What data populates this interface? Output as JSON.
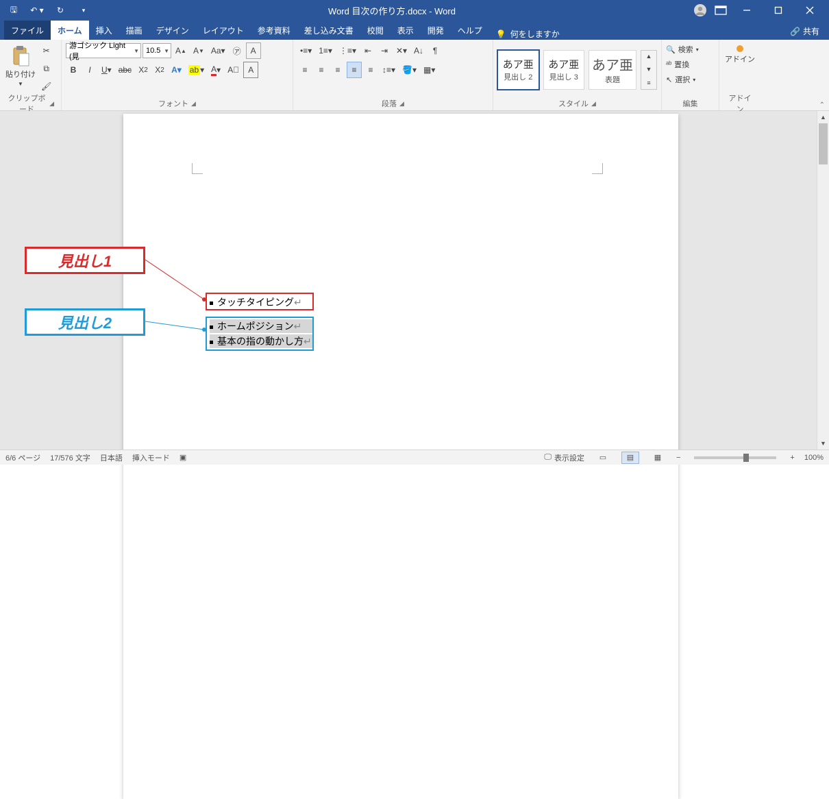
{
  "title": "Word  目次の作り方.docx  -  Word",
  "tabs": {
    "file": "ファイル",
    "home": "ホーム",
    "insert": "挿入",
    "draw": "描画",
    "design": "デザイン",
    "layout": "レイアウト",
    "references": "参考資料",
    "mailings": "差し込み文書",
    "review": "校閲",
    "view": "表示",
    "developer": "開発",
    "help": "ヘルプ"
  },
  "tellme": "何をしますか",
  "share": "共有",
  "ribbon": {
    "clipboard": {
      "paste": "貼り付け",
      "label": "クリップボード"
    },
    "font": {
      "name": "游ゴシック Light (見",
      "size": "10.5",
      "label": "フォント"
    },
    "paragraph": {
      "label": "段落"
    },
    "styles": {
      "label": "スタイル",
      "sample": "あア亜",
      "heading2": "見出し 2",
      "heading3": "見出し 3",
      "title": "表題"
    },
    "editing": {
      "label": "編集",
      "find": "検索",
      "replace": "置換",
      "select": "選択"
    },
    "addin": {
      "label": "アドイン",
      "btn": "アドイン"
    }
  },
  "callouts": {
    "h1": "見出し1",
    "h2": "見出し2"
  },
  "document": {
    "line1": "タッチタイピング",
    "line2": "ホームポジション",
    "line3": "基本の指の動かし方",
    "ret": "↵"
  },
  "status": {
    "page": "6/6 ページ",
    "words": "17/576 文字",
    "lang": "日本語",
    "mode": "挿入モード",
    "display": "表示設定",
    "zoom": "100%"
  }
}
